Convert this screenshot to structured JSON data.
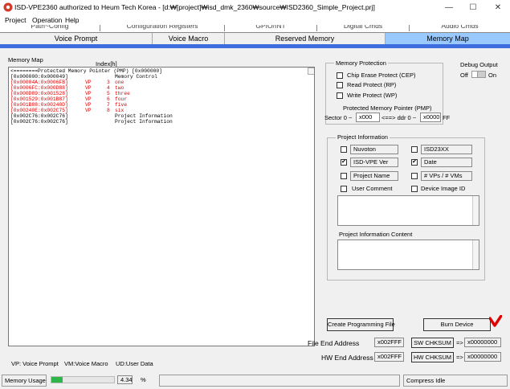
{
  "window": {
    "title": "ISD-VPE2360 authorized to Heum Tech Korea - [d:₩[project]₩isd_dmk_2360₩source₩ISD2360_Simple_Project.prj]",
    "minimize": "—",
    "maximize": "☐",
    "close": "✕"
  },
  "menu": [
    "Project",
    "Operation",
    "Help"
  ],
  "tabs_row1": [
    "Path~Config",
    "Configuration Registers",
    "GPIO/INT",
    "Digital Cmds",
    "Audio Cmds"
  ],
  "tabs_row2": [
    "Voice Prompt",
    "Voice Macro",
    "Reserved Memory",
    "Memory Map"
  ],
  "memory_map": {
    "label": "Memory Map",
    "index_label": "Index[h]",
    "lines": [
      {
        "addr": "<========Protected Memory Pointer (PMP) [0x000000]",
        "vp": "",
        "idx": "",
        "name": "",
        "color": "black"
      },
      {
        "addr": "[0x000000:0x000049]",
        "vp": "",
        "idx": "",
        "name": "Memory Control",
        "color": "black"
      },
      {
        "addr": "[0x00004A:0x0006FB]",
        "vp": "VP",
        "idx": "3",
        "name": "one",
        "color": "red"
      },
      {
        "addr": "[0x0006FC:0x000D88]",
        "vp": "VP",
        "idx": "4",
        "name": "two",
        "color": "red"
      },
      {
        "addr": "[0x000D89:0x001528]",
        "vp": "VP",
        "idx": "5",
        "name": "three",
        "color": "red"
      },
      {
        "addr": "[0x001529:0x001B87]",
        "vp": "VP",
        "idx": "6",
        "name": "four",
        "color": "red"
      },
      {
        "addr": "[0x001B88:0x00240D]",
        "vp": "VP",
        "idx": "7",
        "name": "five",
        "color": "red"
      },
      {
        "addr": "[0x00240E:0x002C75]",
        "vp": "VP",
        "idx": "8",
        "name": "six",
        "color": "red"
      },
      {
        "addr": "[0x002C76:0x002C76]",
        "vp": "",
        "idx": "",
        "name": "Project Information",
        "color": "black"
      },
      {
        "addr": "[0x002C76:0x002C76]",
        "vp": "",
        "idx": "",
        "name": "Project Information",
        "color": "black"
      }
    ]
  },
  "memory_protection": {
    "title": "Memory Protection",
    "chip_erase": "Chip Erase Protect (CEP)",
    "read": "Read Protect (RP)",
    "write": "Write Protect (WP)",
    "pmp_label": "Protected Memory Pointer (PMP)",
    "sector_label": "Sector 0 ~",
    "sector_value": "x000",
    "arrow": "<==> ddr 0 ~",
    "addr_value": "x0000",
    "ff": "FF"
  },
  "debug_output": {
    "title": "Debug Output",
    "off": "Off",
    "on": "On"
  },
  "project_info": {
    "title": "Project Information",
    "fields": [
      {
        "value": "Nuvoton",
        "checked": false
      },
      {
        "value": "ISD23XX",
        "checked": false
      },
      {
        "value": "ISD-VPE Ver",
        "checked": true
      },
      {
        "value": "Date",
        "checked": true
      },
      {
        "value": "Project Name",
        "checked": false
      },
      {
        "value": "# VPs / # VMs",
        "checked": false
      }
    ],
    "user_comment": "User Comment",
    "device_image_id": "Device Image ID",
    "content_label": "Project Information Content"
  },
  "buttons": {
    "create": "Create Programming File",
    "burn": "Burn Device",
    "sw_chksum": "SW CHKSUM",
    "hw_chksum": "HW CHKSUM"
  },
  "file_end": {
    "label": "File End Address",
    "value": "x002FFF",
    "arrow": "=>",
    "chk": "x00000000"
  },
  "hw_end": {
    "label": "HW End Address",
    "value": "x002FFF",
    "arrow": "=>",
    "chk": "x00000000"
  },
  "legend": {
    "vp": "VP: Voice Prompt",
    "vm": "VM:Voice Macro",
    "ud": "UD:User Data"
  },
  "status": {
    "usage_label": "Memory Usage",
    "usage_value": "4.34",
    "usage_fraction": 0.0434,
    "percent": "%",
    "state": "Compress Idle"
  },
  "colors": {
    "accent_tab": "#99c9ff",
    "blue_bar": "#3c6ee0",
    "map_red": "#e00000",
    "checkmark_red": "#e00000",
    "progress_green": "#2fb54a"
  }
}
